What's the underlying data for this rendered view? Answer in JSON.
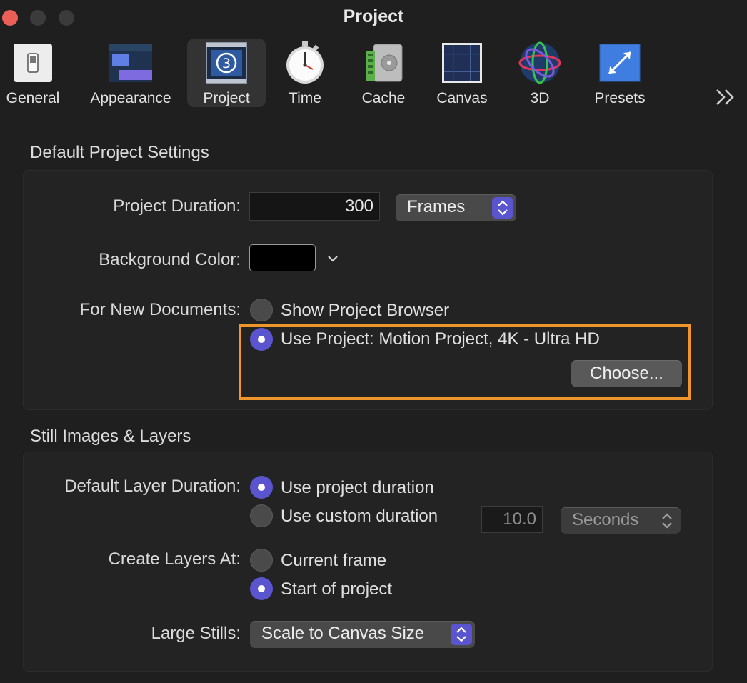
{
  "window": {
    "title": "Project",
    "traffic_colors": {
      "close": "#ec5f57",
      "minimize": "#3b3b3b",
      "zoom": "#3b3b3b"
    }
  },
  "toolbar": {
    "items": [
      {
        "label": "General",
        "icon": "general-icon"
      },
      {
        "label": "Appearance",
        "icon": "appearance-icon"
      },
      {
        "label": "Project",
        "icon": "project-icon",
        "selected": true
      },
      {
        "label": "Time",
        "icon": "stopwatch-icon"
      },
      {
        "label": "Cache",
        "icon": "cache-icon"
      },
      {
        "label": "Canvas",
        "icon": "canvas-icon"
      },
      {
        "label": "3D",
        "icon": "3d-sphere-icon"
      },
      {
        "label": "Presets",
        "icon": "presets-icon"
      }
    ],
    "overflow_icon": "double-chevron-right-icon",
    "project_icon_badge": "3"
  },
  "default_project_settings": {
    "title": "Default Project Settings",
    "duration_label": "Project Duration:",
    "duration_value": "300",
    "duration_unit": "Frames",
    "background_label": "Background Color:",
    "background_color": "#000000",
    "new_docs_label": "For New Documents:",
    "option_browser": "Show Project Browser",
    "option_use_project": "Use Project: Motion Project, 4K - Ultra HD",
    "selected_option": "use_project",
    "choose_button": "Choose...",
    "highlight_color": "#f0952b"
  },
  "still_images": {
    "title": "Still Images & Layers",
    "layer_duration_label": "Default Layer Duration:",
    "option_project_duration": "Use project duration",
    "option_custom_duration": "Use custom duration",
    "custom_value": "10.0",
    "custom_unit": "Seconds",
    "create_at_label": "Create Layers At:",
    "option_current_frame": "Current frame",
    "option_start_project": "Start of project",
    "large_stills_label": "Large Stills:",
    "large_stills_value": "Scale to Canvas Size"
  },
  "accent_color": "#5a55cf"
}
